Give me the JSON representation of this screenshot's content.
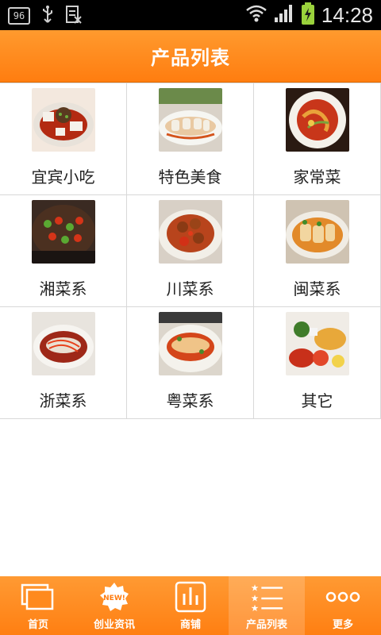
{
  "status_bar": {
    "badge": "96",
    "time": "14:28"
  },
  "header": {
    "title": "产品列表"
  },
  "grid": {
    "items": [
      {
        "label": "宜宾小吃",
        "thumb": "dish-sichuan-tofu"
      },
      {
        "label": "特色美食",
        "thumb": "dish-rolls-plate"
      },
      {
        "label": "家常菜",
        "thumb": "dish-tomato-stirfry"
      },
      {
        "label": "湘菜系",
        "thumb": "dish-hunan-peppers"
      },
      {
        "label": "川菜系",
        "thumb": "dish-sichuan-chicken"
      },
      {
        "label": "闽菜系",
        "thumb": "dish-fujian-rolls"
      },
      {
        "label": "浙菜系",
        "thumb": "dish-zhejiang-fish"
      },
      {
        "label": "粤菜系",
        "thumb": "dish-cantonese-fish"
      },
      {
        "label": "其它",
        "thumb": "dish-platter"
      }
    ]
  },
  "tabbar": {
    "tabs": [
      {
        "label": "首页",
        "icon": "windows-icon"
      },
      {
        "label": "创业资讯",
        "icon": "new-badge-icon"
      },
      {
        "label": "商铺",
        "icon": "bar-chart-icon"
      },
      {
        "label": "产品列表",
        "icon": "star-list-icon",
        "active": true
      },
      {
        "label": "更多",
        "icon": "more-dots-icon"
      }
    ]
  },
  "colors": {
    "accent": "#ff8a1e",
    "divider": "#d8d8d8"
  }
}
